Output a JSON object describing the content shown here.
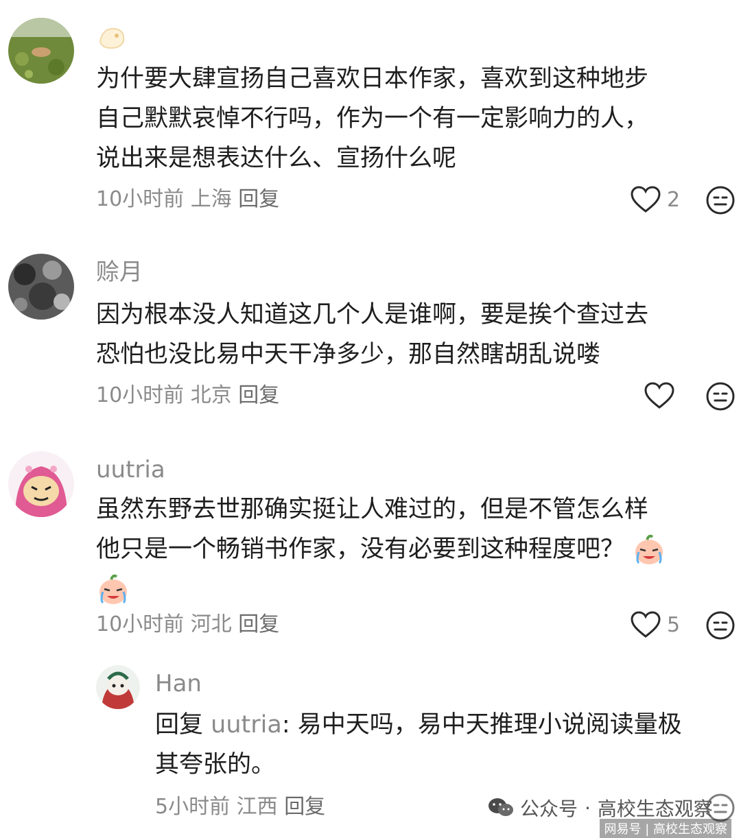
{
  "comments": [
    {
      "username": "",
      "text_lines": [
        "为什要大肆宣扬自己喜欢日本作家，喜欢到这种地步",
        "自己默默哀悼不行吗，作为一个有一定影响力的人，",
        "说出来是想表达什么、宣扬什么呢"
      ],
      "time": "10小时前",
      "location": "上海",
      "reply_label": "回复",
      "like_count": "2"
    },
    {
      "username": "赊月",
      "text_lines": [
        "因为根本没人知道这几个人是谁啊，要是挨个查过去",
        "恐怕也没比易中天干净多少，那自然瞎胡乱说喽"
      ],
      "time": "10小时前",
      "location": "北京",
      "reply_label": "回复",
      "like_count": ""
    },
    {
      "username": "uutria",
      "text_lines": [
        "虽然东野去世那确实挺让人难过的，但是不管怎么样",
        "他只是一个畅销书作家，没有必要到这种程度吧？"
      ],
      "time": "10小时前",
      "location": "河北",
      "reply_label": "回复",
      "like_count": "5"
    }
  ],
  "reply": {
    "username": "Han",
    "reply_prefix": "回复",
    "reply_to": "uutria",
    "text_line1": ": 易中天吗，易中天推理小说阅读量极",
    "text_line2": "其夸张的。",
    "time": "5小时前",
    "location": "江西",
    "reply_label": "回复"
  },
  "watermark": {
    "line1_prefix": "公众号",
    "line1_dot": "·",
    "line1_name": "高校生态观察",
    "line2": "网易号 | 高校生态观察"
  },
  "icons": {
    "like": "heart-outline-icon",
    "dislike": "neutral-face-icon",
    "wechat": "wechat-icon",
    "sticker": "crying-peach-sticker"
  }
}
